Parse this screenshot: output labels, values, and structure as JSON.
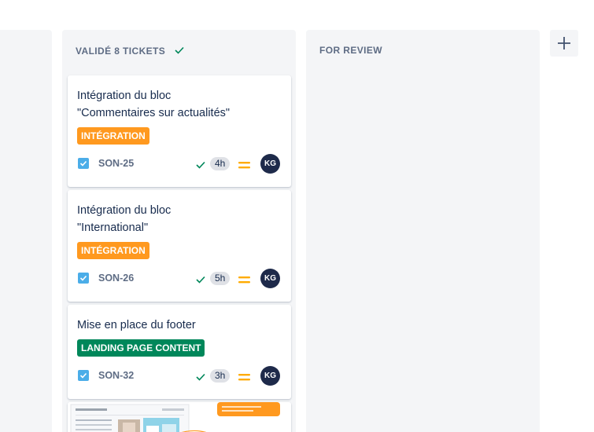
{
  "columns": {
    "valide": {
      "title": "VALIDÉ 8 TICKETS",
      "cards": [
        {
          "title_line1": "Intégration du bloc",
          "title_line2": "\"Commentaires sur actualités\"",
          "label": "INTÉGRATION",
          "key": "SON-25",
          "estimate": "4h",
          "assignee": "KG"
        },
        {
          "title_line1": "Intégration du bloc",
          "title_line2": "\"International\"",
          "label": "INTÉGRATION",
          "key": "SON-26",
          "estimate": "5h",
          "assignee": "KG"
        },
        {
          "title_line1": "Mise en place du footer",
          "label": "LANDING PAGE CONTENT",
          "key": "SON-32",
          "estimate": "3h",
          "assignee": "KG"
        }
      ]
    },
    "review": {
      "title": "FOR REVIEW"
    }
  },
  "colors": {
    "label_integration": "#ff991f",
    "label_landing": "#00875a",
    "done_check": "#00875a",
    "checkbox": "#4bade8",
    "priority_medium": "#ffab00",
    "avatar_bg": "#1e2a4a",
    "column_bg": "#f4f5f7"
  },
  "icons": {
    "add_column": "plus-icon",
    "column_done": "check-icon",
    "issue_type": "task-checkbox-icon",
    "status": "check-icon",
    "priority": "priority-medium-icon"
  }
}
